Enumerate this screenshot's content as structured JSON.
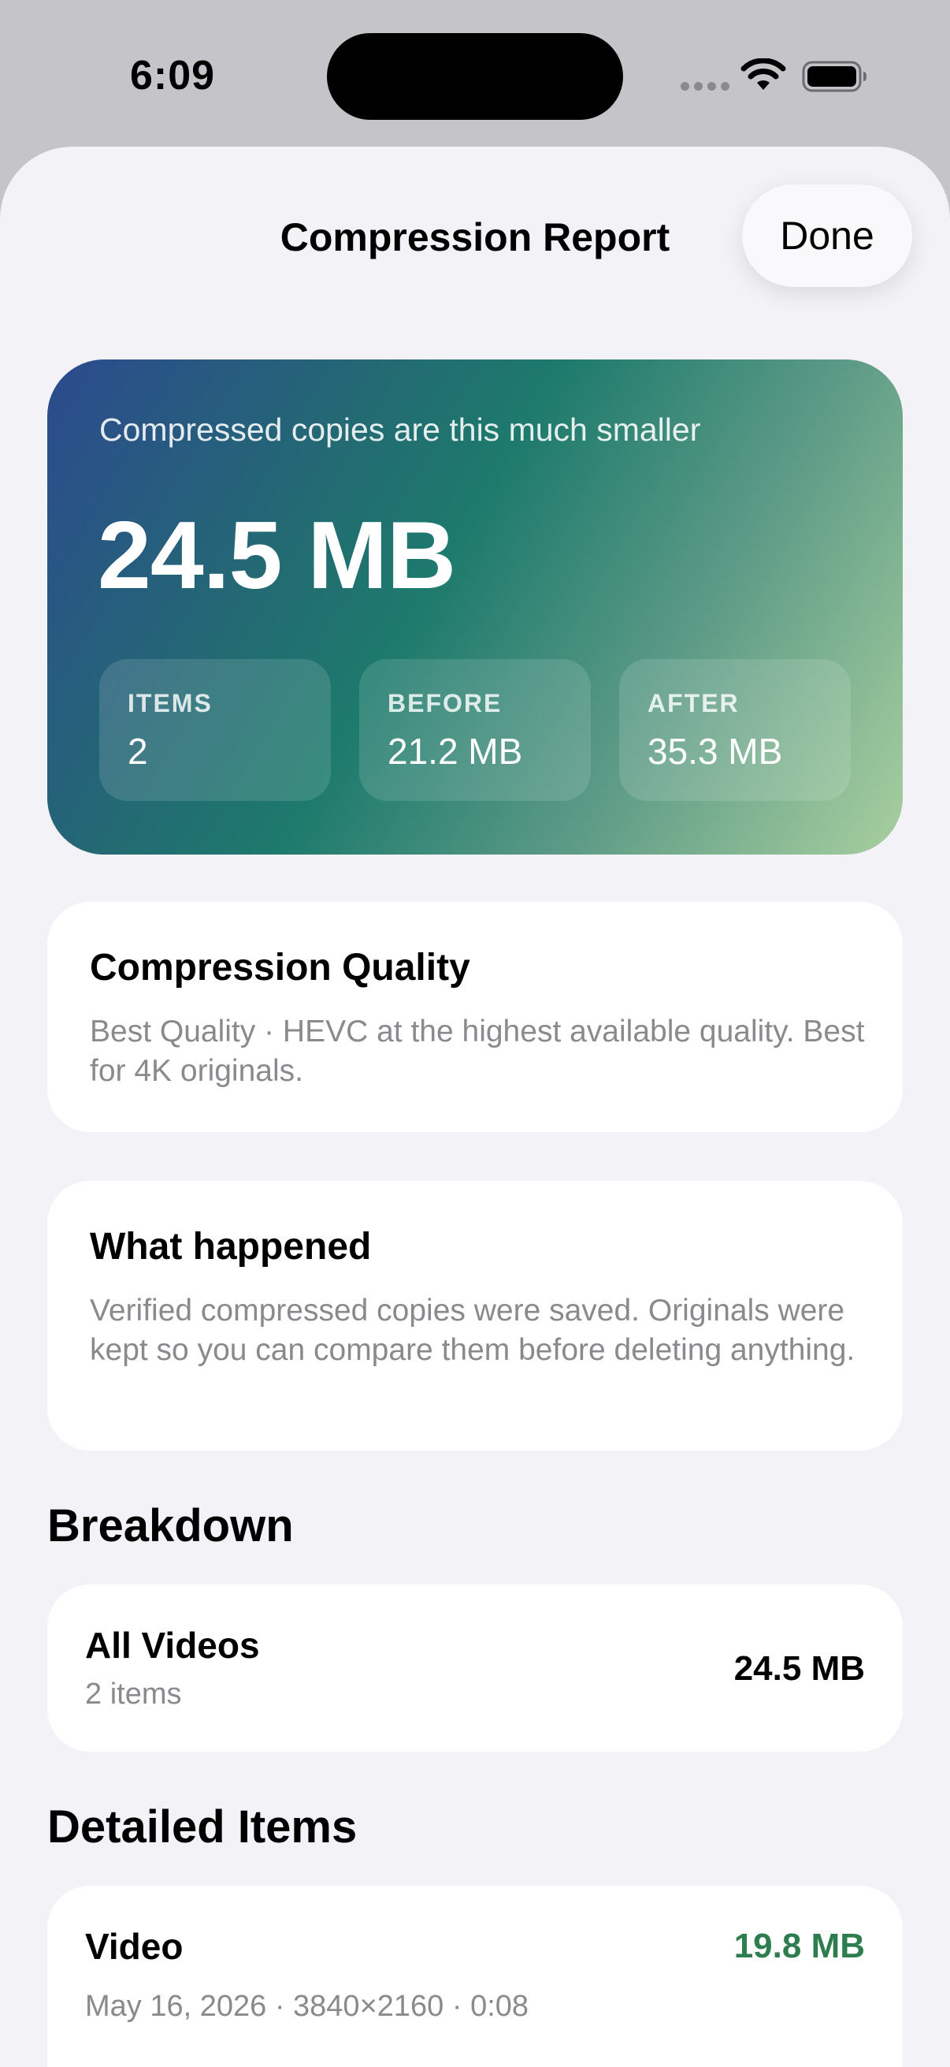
{
  "status_bar": {
    "time": "6:09"
  },
  "sheet": {
    "title": "Compression Report",
    "done_label": "Done"
  },
  "hero": {
    "subtitle": "Compressed copies are this much smaller",
    "value": "24.5 MB",
    "stats": [
      {
        "label": "ITEMS",
        "value": "2"
      },
      {
        "label": "BEFORE",
        "value": "21.2 MB"
      },
      {
        "label": "AFTER",
        "value": "35.3 MB"
      }
    ]
  },
  "quality_card": {
    "title": "Compression Quality",
    "body": "Best Quality · HEVC at the highest available quality. Best for 4K originals."
  },
  "happened_card": {
    "title": "What happened",
    "body": "Verified compressed copies were saved. Originals were kept so you can compare them before deleting anything."
  },
  "breakdown": {
    "header": "Breakdown",
    "rows": [
      {
        "title": "All Videos",
        "subtitle": "2 items",
        "value": "24.5 MB"
      }
    ]
  },
  "detailed": {
    "header": "Detailed Items",
    "items": [
      {
        "title": "Video",
        "subtitle": "May 16, 2026 · 3840×2160 · 0:08",
        "value": "19.8 MB",
        "value_color": "#2e7d4f"
      }
    ]
  },
  "icons": {
    "wifi": "wifi-icon",
    "battery": "battery-icon",
    "cellular": "cellular-signal-icon"
  }
}
